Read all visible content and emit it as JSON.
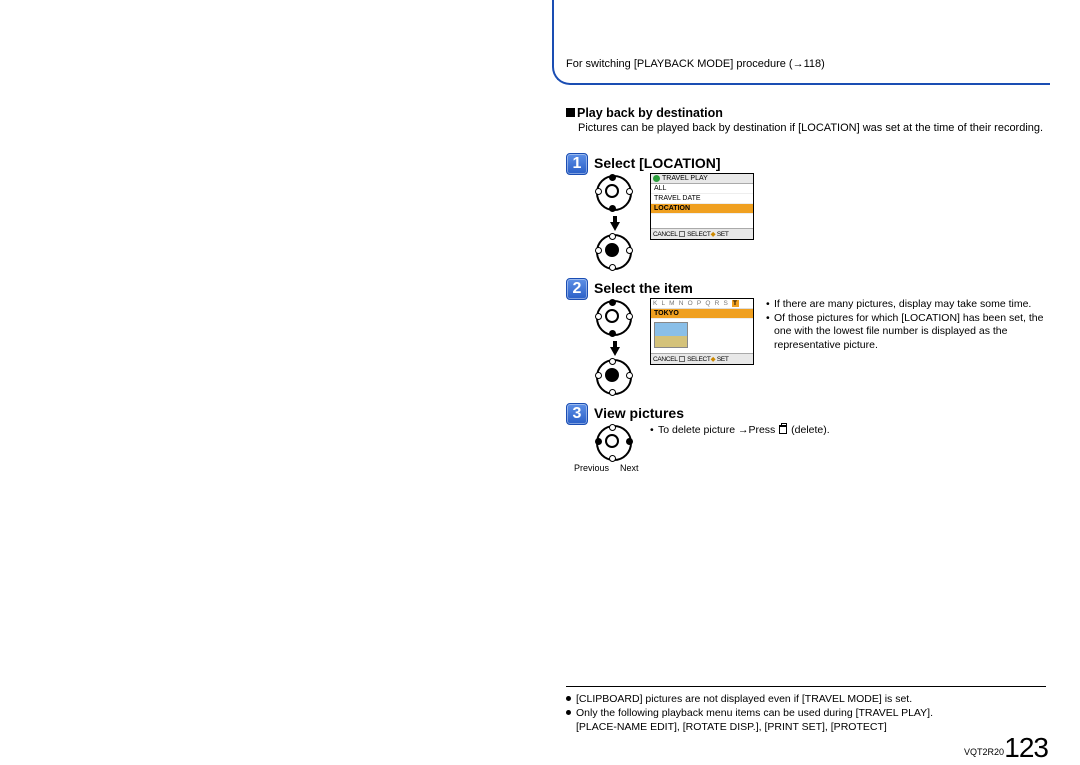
{
  "top_note": "For switching [PLAYBACK MODE] procedure (→118)",
  "section_title": "Play back by destination",
  "section_desc": "Pictures can be played back by destination if [LOCATION] was set at the time of their recording.",
  "steps": {
    "s1": {
      "num": "1",
      "title": "Select [LOCATION]"
    },
    "s2": {
      "num": "2",
      "title": "Select the item"
    },
    "s3": {
      "num": "3",
      "title": "View pictures"
    }
  },
  "screen1": {
    "title": "TRAVEL PLAY",
    "row1": "ALL",
    "row2": "TRAVEL DATE",
    "row3": "LOCATION",
    "footer_cancel": "CANCEL",
    "footer_select": "SELECT",
    "footer_set": "SET"
  },
  "screen2": {
    "alpha": "K L M N O P Q R S T",
    "loc": "TOKYO",
    "footer_cancel": "CANCEL",
    "footer_select": "SELECT",
    "footer_set": "SET"
  },
  "step2_notes": {
    "n1": "If there are many pictures, display may take some time.",
    "n2": "Of those pictures for which [LOCATION] has been set, the one with the lowest file number is displayed as the representative picture."
  },
  "step3_note_pre": "To delete picture →Press ",
  "step3_note_post": " (delete).",
  "prev": "Previous",
  "next": "Next",
  "footnotes": {
    "f1": "[CLIPBOARD] pictures are not displayed even if [TRAVEL MODE] is set.",
    "f2": "Only the following playback menu items can be used during [TRAVEL PLAY].",
    "f2b": "[PLACE-NAME EDIT], [ROTATE DISP.], [PRINT SET], [PROTECT]"
  },
  "docid": "VQT2R20",
  "pagenum": "123"
}
